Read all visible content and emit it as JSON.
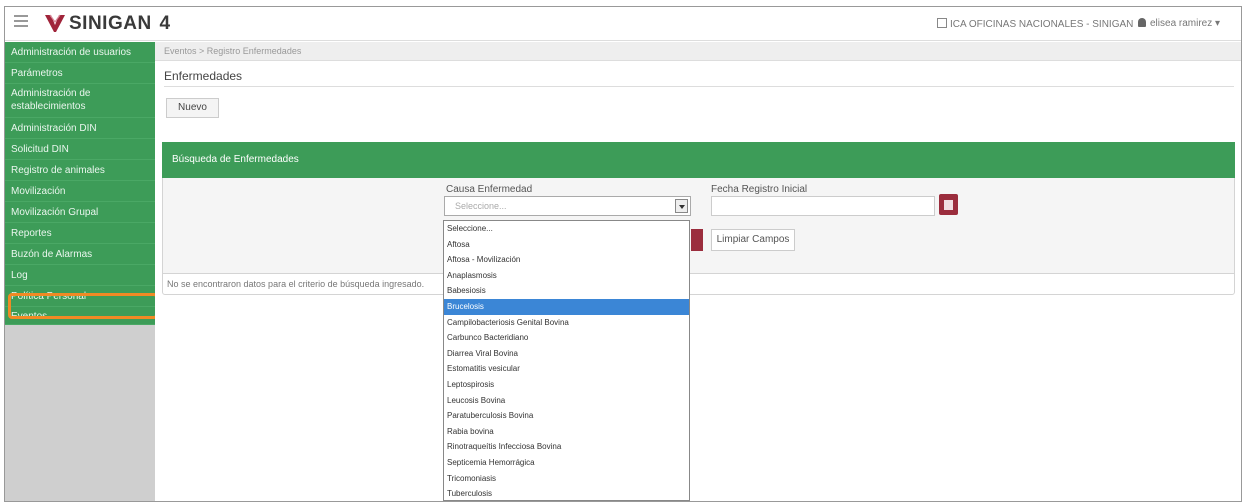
{
  "header": {
    "app_name": "SINIGAN",
    "app_version": "4",
    "office": "ICA OFICINAS NACIONALES - SINIGAN",
    "user": "elisea ramirez"
  },
  "sidebar": {
    "items": [
      {
        "label": "Administración de usuarios"
      },
      {
        "label": "Parámetros"
      },
      {
        "label": "Administración de establecimientos"
      },
      {
        "label": "Administración DIN"
      },
      {
        "label": "Solicitud DIN"
      },
      {
        "label": "Registro de animales"
      },
      {
        "label": "Movilización"
      },
      {
        "label": "Movilización Grupal"
      },
      {
        "label": "Reportes"
      },
      {
        "label": "Buzón de Alarmas"
      },
      {
        "label": "Log"
      },
      {
        "label": "Política Personal"
      },
      {
        "label": "Eventos"
      }
    ]
  },
  "main": {
    "breadcrumb": "Eventos > Registro Enfermedades",
    "page_title": "Enfermedades",
    "new_button": "Nuevo",
    "search_panel_title": "Búsqueda de Enfermedades",
    "cause_label": "Causa Enfermedad",
    "cause_placeholder": "Seleccione...",
    "date_label": "Fecha Registro Inicial",
    "clear_button": "Limpiar Campos",
    "no_results": "No se encontraron datos para el criterio de búsqueda ingresado."
  },
  "dropdown": {
    "selected_index": 5,
    "options": [
      "Seleccione...",
      "Aftosa",
      "Aftosa - Movilización",
      "Anaplasmosis",
      "Babesiosis",
      "Brucelosis",
      "Campilobacteriosis Genital Bovina",
      "Carbunco Bacteridiano",
      "Diarrea Viral Bovina",
      "Estomatitis vesicular",
      "Leptospirosis",
      "Leucosis Bovina",
      "Paratuberculosis Bovina",
      "Rabia bovina",
      "Rinotraqueítis Infecciosa Bovina",
      "Septicemia Hemorrágica",
      "Tricomoniasis",
      "Tuberculosis"
    ]
  },
  "colors": {
    "accent_green": "#3d9c58",
    "brand_red": "#9b2d3d",
    "highlight_orange": "#f08a24",
    "selection_blue": "#3b86d6"
  }
}
